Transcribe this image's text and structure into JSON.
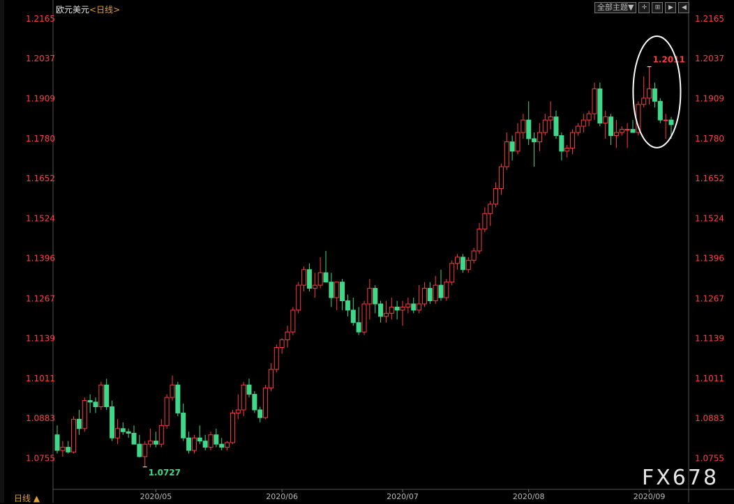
{
  "header": {
    "symbol": "欧元美元",
    "timeframe_label": "<日线>",
    "theme_button": "全部主题▼",
    "buttons": [
      "✛",
      "⊞",
      "▶",
      "◀"
    ]
  },
  "footer": {
    "timeframe": "日线 ▲"
  },
  "watermark": "FX678",
  "colors": {
    "up": "#ff3c3c",
    "down": "#3fd88a",
    "axis_text": "#ff4040",
    "grid": "#4a4a4a",
    "background": "#000000",
    "ellipse": "#ffffff"
  },
  "chart_data": {
    "type": "candlestick",
    "title": "欧元美元<日线>",
    "ylim": [
      1.0655,
      1.2225
    ],
    "y_ticks": [
      "1.2165",
      "1.2037",
      "1.1909",
      "1.1780",
      "1.1652",
      "1.1524",
      "1.1396",
      "1.1267",
      "1.1139",
      "1.1011",
      "1.0883",
      "1.0755"
    ],
    "x_ticks": [
      "2020/05",
      "2020/06",
      "2020/07",
      "2020/08",
      "2020/09"
    ],
    "annotations": [
      {
        "label": "1.2011",
        "type": "high",
        "value": 1.2011
      },
      {
        "label": "1.0727",
        "type": "low",
        "value": 1.0727
      }
    ],
    "candles": [
      [
        1.083,
        1.086,
        1.077,
        1.078
      ],
      [
        1.078,
        1.081,
        1.076,
        1.079
      ],
      [
        1.079,
        1.081,
        1.077,
        1.0775
      ],
      [
        1.0775,
        1.089,
        1.077,
        1.088
      ],
      [
        1.088,
        1.091,
        1.083,
        1.085
      ],
      [
        1.085,
        1.095,
        1.084,
        1.094
      ],
      [
        1.094,
        1.096,
        1.09,
        1.0935
      ],
      [
        1.0935,
        1.095,
        1.09,
        1.092
      ],
      [
        1.092,
        1.1,
        1.091,
        1.099
      ],
      [
        1.099,
        1.101,
        1.091,
        1.092
      ],
      [
        1.092,
        1.094,
        1.081,
        1.082
      ],
      [
        1.082,
        1.088,
        1.08,
        1.085
      ],
      [
        1.085,
        1.087,
        1.083,
        1.084
      ],
      [
        1.084,
        1.085,
        1.082,
        1.0835
      ],
      [
        1.0835,
        1.086,
        1.08,
        1.08
      ],
      [
        1.08,
        1.083,
        1.0757,
        1.076
      ],
      [
        1.076,
        1.081,
        1.0727,
        1.08
      ],
      [
        1.08,
        1.085,
        1.079,
        1.081
      ],
      [
        1.081,
        1.084,
        1.079,
        1.08
      ],
      [
        1.08,
        1.088,
        1.079,
        1.086
      ],
      [
        1.086,
        1.096,
        1.085,
        1.095
      ],
      [
        1.095,
        1.102,
        1.094,
        1.099
      ],
      [
        1.099,
        1.1,
        1.089,
        1.09
      ],
      [
        1.09,
        1.093,
        1.081,
        1.082
      ],
      [
        1.082,
        1.084,
        1.077,
        1.078
      ],
      [
        1.078,
        1.083,
        1.077,
        1.082
      ],
      [
        1.082,
        1.086,
        1.08,
        1.081
      ],
      [
        1.081,
        1.083,
        1.078,
        1.079
      ],
      [
        1.079,
        1.084,
        1.078,
        1.083
      ],
      [
        1.083,
        1.085,
        1.079,
        1.08
      ],
      [
        1.08,
        1.082,
        1.078,
        1.079
      ],
      [
        1.079,
        1.081,
        1.078,
        1.0805
      ],
      [
        1.0805,
        1.091,
        1.08,
        1.09
      ],
      [
        1.09,
        1.096,
        1.088,
        1.091
      ],
      [
        1.091,
        1.1,
        1.089,
        1.099
      ],
      [
        1.099,
        1.101,
        1.095,
        1.096
      ],
      [
        1.096,
        1.097,
        1.09,
        1.091
      ],
      [
        1.091,
        1.092,
        1.087,
        1.0885
      ],
      [
        1.0885,
        1.099,
        1.088,
        1.098
      ],
      [
        1.098,
        1.106,
        1.097,
        1.104
      ],
      [
        1.104,
        1.112,
        1.103,
        1.111
      ],
      [
        1.111,
        1.114,
        1.109,
        1.1135
      ],
      [
        1.1135,
        1.118,
        1.111,
        1.116
      ],
      [
        1.116,
        1.124,
        1.115,
        1.123
      ],
      [
        1.123,
        1.132,
        1.122,
        1.131
      ],
      [
        1.131,
        1.137,
        1.129,
        1.136
      ],
      [
        1.136,
        1.138,
        1.129,
        1.13
      ],
      [
        1.13,
        1.135,
        1.127,
        1.131
      ],
      [
        1.131,
        1.14,
        1.13,
        1.135
      ],
      [
        1.135,
        1.142,
        1.132,
        1.132
      ],
      [
        1.132,
        1.135,
        1.124,
        1.127
      ],
      [
        1.127,
        1.132,
        1.123,
        1.132
      ],
      [
        1.132,
        1.133,
        1.123,
        1.126
      ],
      [
        1.126,
        1.128,
        1.121,
        1.123
      ],
      [
        1.123,
        1.127,
        1.118,
        1.119
      ],
      [
        1.119,
        1.124,
        1.115,
        1.116
      ],
      [
        1.116,
        1.126,
        1.115,
        1.125
      ],
      [
        1.125,
        1.133,
        1.12,
        1.13
      ],
      [
        1.13,
        1.131,
        1.122,
        1.125
      ],
      [
        1.125,
        1.126,
        1.119,
        1.121
      ],
      [
        1.121,
        1.126,
        1.119,
        1.122
      ],
      [
        1.122,
        1.127,
        1.12,
        1.124
      ],
      [
        1.124,
        1.126,
        1.12,
        1.123
      ],
      [
        1.123,
        1.126,
        1.118,
        1.124
      ],
      [
        1.124,
        1.127,
        1.122,
        1.125
      ],
      [
        1.125,
        1.127,
        1.122,
        1.123
      ],
      [
        1.123,
        1.131,
        1.122,
        1.125
      ],
      [
        1.125,
        1.132,
        1.124,
        1.13
      ],
      [
        1.13,
        1.132,
        1.125,
        1.126
      ],
      [
        1.126,
        1.134,
        1.125,
        1.131
      ],
      [
        1.131,
        1.136,
        1.126,
        1.127
      ],
      [
        1.127,
        1.133,
        1.126,
        1.132
      ],
      [
        1.132,
        1.139,
        1.131,
        1.138
      ],
      [
        1.138,
        1.141,
        1.136,
        1.14
      ],
      [
        1.14,
        1.141,
        1.135,
        1.136
      ],
      [
        1.136,
        1.14,
        1.135,
        1.139
      ],
      [
        1.139,
        1.143,
        1.138,
        1.142
      ],
      [
        1.142,
        1.151,
        1.141,
        1.149
      ],
      [
        1.149,
        1.156,
        1.148,
        1.154
      ],
      [
        1.154,
        1.158,
        1.15,
        1.157
      ],
      [
        1.157,
        1.164,
        1.156,
        1.162
      ],
      [
        1.162,
        1.17,
        1.16,
        1.169
      ],
      [
        1.169,
        1.18,
        1.168,
        1.177
      ],
      [
        1.177,
        1.179,
        1.171,
        1.174
      ],
      [
        1.174,
        1.183,
        1.173,
        1.18
      ],
      [
        1.18,
        1.186,
        1.178,
        1.184
      ],
      [
        1.184,
        1.19,
        1.176,
        1.178
      ],
      [
        1.178,
        1.18,
        1.169,
        1.177
      ],
      [
        1.177,
        1.183,
        1.174,
        1.18
      ],
      [
        1.18,
        1.186,
        1.179,
        1.184
      ],
      [
        1.184,
        1.19,
        1.181,
        1.185
      ],
      [
        1.185,
        1.187,
        1.178,
        1.179
      ],
      [
        1.179,
        1.18,
        1.171,
        1.174
      ],
      [
        1.174,
        1.176,
        1.172,
        1.175
      ],
      [
        1.175,
        1.181,
        1.173,
        1.18
      ],
      [
        1.18,
        1.183,
        1.179,
        1.182
      ],
      [
        1.182,
        1.186,
        1.18,
        1.184
      ],
      [
        1.184,
        1.187,
        1.182,
        1.186
      ],
      [
        1.186,
        1.196,
        1.184,
        1.194
      ],
      [
        1.194,
        1.196,
        1.182,
        1.183
      ],
      [
        1.183,
        1.187,
        1.178,
        1.185
      ],
      [
        1.185,
        1.186,
        1.176,
        1.179
      ],
      [
        1.179,
        1.184,
        1.175,
        1.18
      ],
      [
        1.18,
        1.182,
        1.179,
        1.181
      ],
      [
        1.181,
        1.183,
        1.175,
        1.181
      ],
      [
        1.181,
        1.184,
        1.18,
        1.18
      ],
      [
        1.18,
        1.19,
        1.179,
        1.189
      ],
      [
        1.189,
        1.198,
        1.188,
        1.191
      ],
      [
        1.191,
        1.2011,
        1.189,
        1.194
      ],
      [
        1.194,
        1.196,
        1.188,
        1.19
      ],
      [
        1.19,
        1.191,
        1.183,
        1.184
      ],
      [
        1.184,
        1.186,
        1.178,
        1.184
      ],
      [
        1.184,
        1.185,
        1.178,
        1.1825
      ]
    ]
  }
}
